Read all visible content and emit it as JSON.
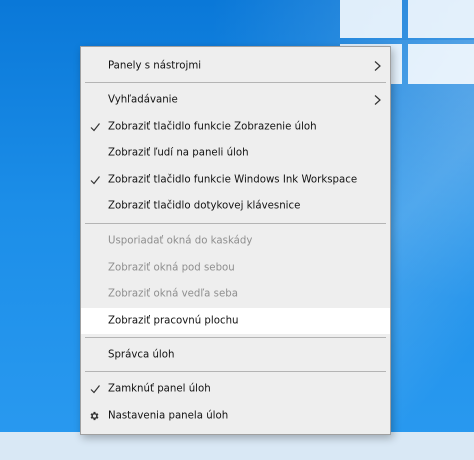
{
  "menu": {
    "items": [
      {
        "label": "Panely s nástrojmi"
      },
      {
        "label": "Vyhľadávanie"
      },
      {
        "label": "Zobraziť tlačidlo funkcie Zobrazenie úloh"
      },
      {
        "label": "Zobraziť ľudí na paneli úloh"
      },
      {
        "label": "Zobraziť tlačidlo funkcie Windows Ink Workspace"
      },
      {
        "label": "Zobraziť tlačidlo dotykovej klávesnice"
      },
      {
        "label": "Usporiadať okná do kaskády"
      },
      {
        "label": "Zobraziť okná pod sebou"
      },
      {
        "label": "Zobraziť okná vedľa seba"
      },
      {
        "label": "Zobraziť pracovnú plochu"
      },
      {
        "label": "Správca úloh"
      },
      {
        "label": "Zamknúť panel úloh"
      },
      {
        "label": "Nastavenia panela úloh"
      }
    ]
  },
  "colors": {
    "desktop": "#1c8ee8",
    "menu_bg": "#eeeeee",
    "highlight": "#ffffff",
    "disabled_text": "#8e8e8e"
  }
}
